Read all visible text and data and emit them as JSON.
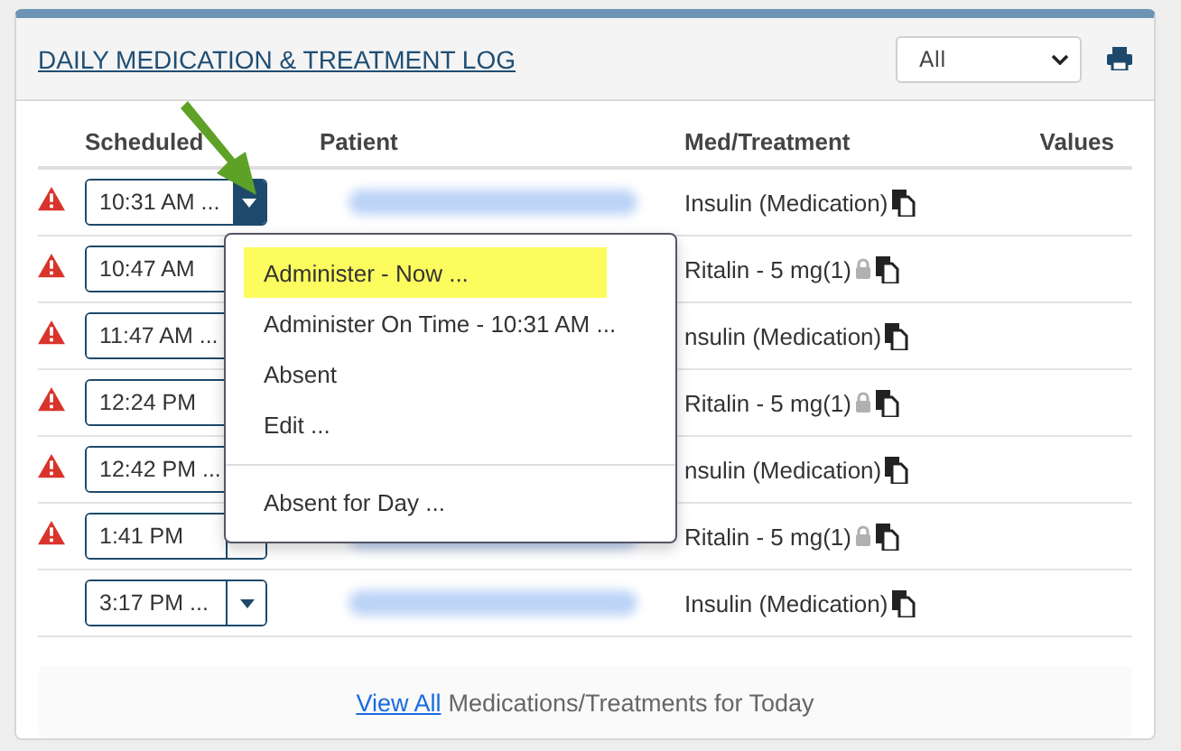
{
  "panel": {
    "title": "DAILY MEDICATION & TREATMENT LOG",
    "filter": "All"
  },
  "columns": [
    "Scheduled",
    "Patient",
    "Med/Treatment",
    "Values"
  ],
  "rows": [
    {
      "time": "10:31 AM ...",
      "alert": true,
      "med": "Insulin (Medication)",
      "locked": false
    },
    {
      "time": "10:47 AM",
      "alert": true,
      "med": "Ritalin - 5 mg(1)",
      "locked": true
    },
    {
      "time": "11:47 AM ...",
      "alert": true,
      "med": "nsulin (Medication)",
      "locked": false
    },
    {
      "time": "12:24 PM",
      "alert": true,
      "med": "Ritalin - 5 mg(1)",
      "locked": true
    },
    {
      "time": "12:42 PM ...",
      "alert": true,
      "med": "nsulin (Medication)",
      "locked": false
    },
    {
      "time": "1:41 PM",
      "alert": true,
      "med": "Ritalin - 5 mg(1)",
      "locked": true
    },
    {
      "time": "3:17 PM ...",
      "alert": false,
      "med": "Insulin (Medication)",
      "locked": false
    }
  ],
  "dropdown": {
    "open": true,
    "items": [
      {
        "label": "Administer - Now ...",
        "selected": true
      },
      {
        "label": "Administer On Time - 10:31 AM ...",
        "selected": false
      },
      {
        "label": "Absent",
        "selected": false
      },
      {
        "label": "Edit ...",
        "selected": false
      },
      {
        "kind": "divider"
      },
      {
        "label": "Absent for Day ...",
        "selected": false
      }
    ]
  },
  "footer": {
    "link": "View All",
    "text": "Medications/Treatments for Today"
  }
}
